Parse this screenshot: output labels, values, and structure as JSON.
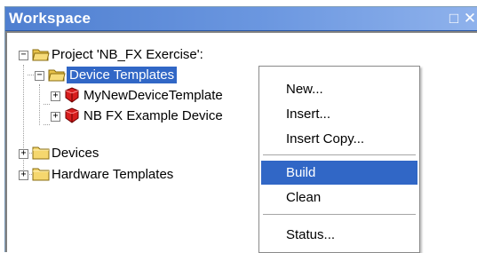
{
  "window": {
    "title": "Workspace",
    "restore_glyph": "□",
    "close_glyph": "✕"
  },
  "tree": {
    "project_label": "Project 'NB_FX Exercise':",
    "device_templates_label": "Device Templates",
    "template_1_label": "MyNewDeviceTemplate",
    "template_2_label": "NB FX Example Device",
    "devices_label": "Devices",
    "hardware_templates_label": "Hardware Templates",
    "collapse_glyph": "−",
    "expand_glyph": "+"
  },
  "context_menu": {
    "items": [
      {
        "label": "New..."
      },
      {
        "label": "Insert..."
      },
      {
        "label": "Insert Copy..."
      },
      {
        "label": "Build"
      },
      {
        "label": "Clean"
      },
      {
        "label": "Status..."
      }
    ]
  },
  "colors": {
    "selection": "#3167c6",
    "titlebar": "#4f7fd0",
    "folder": "#f5d76e",
    "device_red": "#d81e1e"
  }
}
